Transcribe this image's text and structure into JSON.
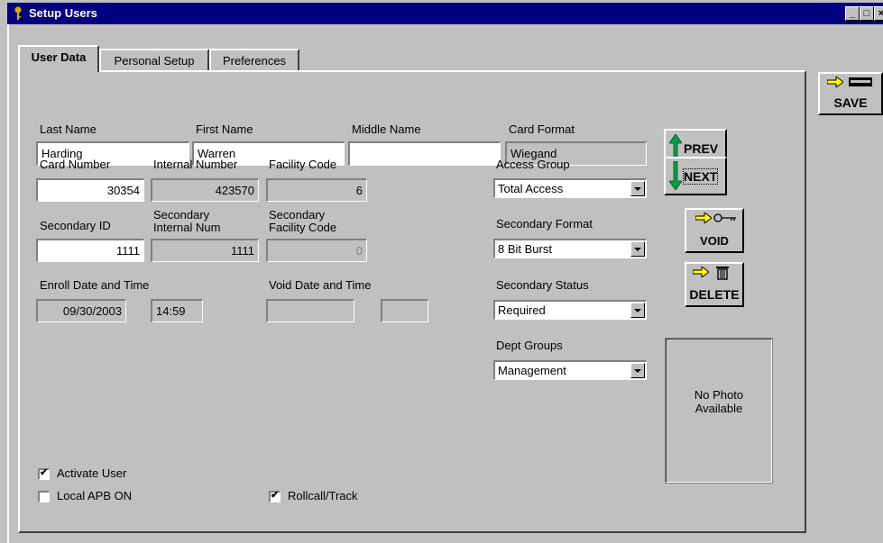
{
  "window": {
    "title": "Setup Users",
    "min_glyph": "_",
    "max_glyph": "□",
    "close_glyph": "×"
  },
  "tabs": [
    {
      "label": "User Data",
      "active": true
    },
    {
      "label": "Personal Setup",
      "active": false
    },
    {
      "label": "Preferences",
      "active": false
    }
  ],
  "name": {
    "last_label": "Last Name",
    "last_value": "Harding",
    "first_label": "First Name",
    "first_value": "Warren",
    "middle_label": "Middle Name",
    "middle_value": "",
    "card_format_label": "Card Format",
    "card_format_value": "Wiegand"
  },
  "card": {
    "card_number_label": "Card Number",
    "card_number_value": "30354",
    "internal_number_label": "Internal Number",
    "internal_number_value": "423570",
    "facility_code_label": "Facility Code",
    "facility_code_value": "6",
    "secondary_id_label": "Secondary ID",
    "secondary_id_value": "1111",
    "secondary_internal_label_1": "Secondary",
    "secondary_internal_label_2": "Internal Num",
    "secondary_internal_value": "1111",
    "secondary_facility_label_1": "Secondary",
    "secondary_facility_label_2": "Facility Code",
    "secondary_facility_value": "0"
  },
  "dates": {
    "enroll_label": "Enroll Date and Time",
    "enroll_date": "09/30/2003",
    "enroll_time": "14:59",
    "void_label": "Void Date and Time",
    "void_date": "",
    "void_time": ""
  },
  "selects": {
    "access_group_label": "Access Group",
    "access_group_value": "Total Access",
    "secondary_format_label": "Secondary Format",
    "secondary_format_value": "8 Bit Burst",
    "secondary_status_label": "Secondary Status",
    "secondary_status_value": "Required",
    "dept_groups_label": "Dept Groups",
    "dept_groups_value": "Management"
  },
  "buttons": {
    "prev": "PREV",
    "next": "NEXT",
    "void": "VOID",
    "delete": "DELETE",
    "save": "SAVE"
  },
  "photo": {
    "line1": "No Photo",
    "line2": "Available"
  },
  "checkboxes": {
    "activate_user": {
      "label": "Activate User",
      "checked": true
    },
    "local_apb": {
      "label": "Local APB ON",
      "checked": false
    },
    "rollcall": {
      "label": "Rollcall/Track",
      "checked": true
    }
  },
  "colors": {
    "titlebar": "#000080",
    "face": "#c0c0c0",
    "prev_arrow": "#00a040",
    "next_arrow": "#00a040",
    "pointer_arrow": "#ffff00"
  },
  "icons": [
    "app-key-icon",
    "up-arrow-icon",
    "down-arrow-icon",
    "key-icon",
    "trash-icon",
    "card-icon",
    "pointer-arrow-icon"
  ]
}
